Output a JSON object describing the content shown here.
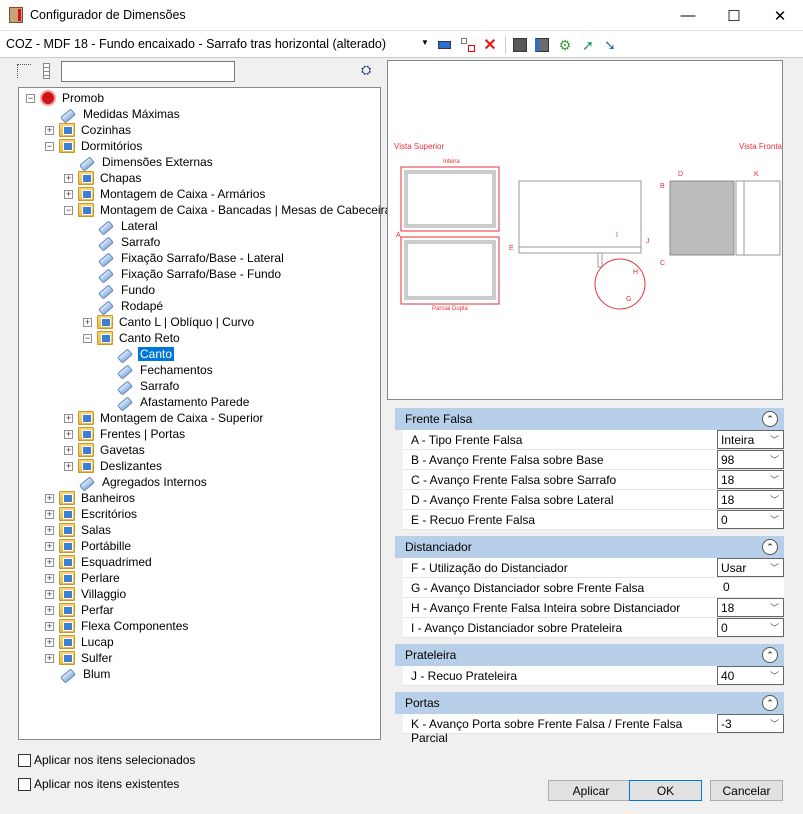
{
  "window": {
    "title": "Configurador de Dimensões",
    "minimize": "—",
    "maximize": "☐",
    "close": "✕"
  },
  "toolbar": {
    "config": "COZ - MDF 18 - Fundo encaixado - Sarrafo tras horizontal (alterado)"
  },
  "search": {
    "value": ""
  },
  "tree": [
    {
      "label": "Promob",
      "level": 0,
      "type": "root",
      "exp": "-"
    },
    {
      "label": "Medidas Máximas",
      "level": 1,
      "type": "tag"
    },
    {
      "label": "Cozinhas",
      "level": 1,
      "type": "folder",
      "exp": "+"
    },
    {
      "label": "Dormitórios",
      "level": 1,
      "type": "folder",
      "exp": "-"
    },
    {
      "label": "Dimensões Externas",
      "level": 2,
      "type": "tag"
    },
    {
      "label": "Chapas",
      "level": 2,
      "type": "folder",
      "exp": "+"
    },
    {
      "label": "Montagem de Caixa - Armários",
      "level": 2,
      "type": "folder",
      "exp": "+"
    },
    {
      "label": "Montagem de Caixa - Bancadas | Mesas de Cabeceira",
      "level": 2,
      "type": "folder",
      "exp": "-"
    },
    {
      "label": "Lateral",
      "level": 3,
      "type": "tag"
    },
    {
      "label": "Sarrafo",
      "level": 3,
      "type": "tag"
    },
    {
      "label": "Fixação Sarrafo/Base - Lateral",
      "level": 3,
      "type": "tag"
    },
    {
      "label": "Fixação Sarrafo/Base - Fundo",
      "level": 3,
      "type": "tag"
    },
    {
      "label": "Fundo",
      "level": 3,
      "type": "tag"
    },
    {
      "label": "Rodapé",
      "level": 3,
      "type": "tag"
    },
    {
      "label": "Canto L | Oblíquo | Curvo",
      "level": 3,
      "type": "folder",
      "exp": "+"
    },
    {
      "label": "Canto Reto",
      "level": 3,
      "type": "folder",
      "exp": "-"
    },
    {
      "label": "Canto",
      "level": 4,
      "type": "tag",
      "selected": true
    },
    {
      "label": "Fechamentos",
      "level": 4,
      "type": "tag"
    },
    {
      "label": "Sarrafo",
      "level": 4,
      "type": "tag"
    },
    {
      "label": "Afastamento Parede",
      "level": 4,
      "type": "tag"
    },
    {
      "label": "Montagem de Caixa - Superior",
      "level": 2,
      "type": "folder",
      "exp": "+"
    },
    {
      "label": "Frentes | Portas",
      "level": 2,
      "type": "folder",
      "exp": "+"
    },
    {
      "label": "Gavetas",
      "level": 2,
      "type": "folder",
      "exp": "+"
    },
    {
      "label": "Deslizantes",
      "level": 2,
      "type": "folder",
      "exp": "+"
    },
    {
      "label": "Agregados Internos",
      "level": 2,
      "type": "tag"
    },
    {
      "label": "Banheiros",
      "level": 1,
      "type": "folder",
      "exp": "+"
    },
    {
      "label": "Escritórios",
      "level": 1,
      "type": "folder",
      "exp": "+"
    },
    {
      "label": "Salas",
      "level": 1,
      "type": "folder",
      "exp": "+"
    },
    {
      "label": "Portábille",
      "level": 1,
      "type": "folder",
      "exp": "+"
    },
    {
      "label": "Esquadrimed",
      "level": 1,
      "type": "folder",
      "exp": "+"
    },
    {
      "label": "Perlare",
      "level": 1,
      "type": "folder",
      "exp": "+"
    },
    {
      "label": "Villaggio",
      "level": 1,
      "type": "folder",
      "exp": "+"
    },
    {
      "label": "Perfar",
      "level": 1,
      "type": "folder",
      "exp": "+"
    },
    {
      "label": "Flexa Componentes",
      "level": 1,
      "type": "folder",
      "exp": "+"
    },
    {
      "label": "Lucap",
      "level": 1,
      "type": "folder",
      "exp": "+"
    },
    {
      "label": "Sulfer",
      "level": 1,
      "type": "folder",
      "exp": "+"
    },
    {
      "label": "Blum",
      "level": 1,
      "type": "tag"
    }
  ],
  "diagram": {
    "top_view": "Vista Superior",
    "front_view": "Vista Frontal",
    "inteira": "Inteira",
    "parcial": "Parcial Dupla",
    "A": "A",
    "B": "B",
    "C": "C",
    "D": "D",
    "E": "E",
    "G": "G",
    "H": "H",
    "I": "I",
    "J": "J",
    "K": "K"
  },
  "properties": [
    {
      "section": "Frente Falsa",
      "rows": [
        {
          "name": "A - Tipo Frente Falsa",
          "value": "Inteira",
          "dropdown": true
        },
        {
          "name": "B - Avanço Frente Falsa sobre Base",
          "value": "98",
          "dropdown": true
        },
        {
          "name": "C - Avanço Frente Falsa sobre Sarrafo",
          "value": "18",
          "dropdown": true
        },
        {
          "name": "D - Avanço Frente Falsa sobre Lateral",
          "value": "18",
          "dropdown": true
        },
        {
          "name": "E - Recuo Frente Falsa",
          "value": "0",
          "dropdown": true
        }
      ]
    },
    {
      "section": "Distanciador",
      "rows": [
        {
          "name": "F - Utilização do Distanciador",
          "value": "Usar",
          "dropdown": true
        },
        {
          "name": "G - Avanço Distanciador sobre Frente Falsa",
          "value": "0",
          "dropdown": false
        },
        {
          "name": "H - Avanço Frente Falsa Inteira sobre Distanciador",
          "value": "18",
          "dropdown": true
        },
        {
          "name": "I - Avanço Distanciador sobre Prateleira",
          "value": "0",
          "dropdown": true
        }
      ]
    },
    {
      "section": "Prateleira",
      "rows": [
        {
          "name": "J - Recuo Prateleira",
          "value": "40",
          "dropdown": true
        }
      ]
    },
    {
      "section": "Portas",
      "rows": [
        {
          "name": "K - Avanço Porta sobre Frente Falsa / Frente Falsa Parcial",
          "value": "-3",
          "dropdown": true
        }
      ]
    }
  ],
  "options": {
    "apply_selected": "Aplicar nos itens selecionados",
    "apply_existing": "Aplicar nos itens existentes"
  },
  "buttons": {
    "apply": "Aplicar",
    "ok": "OK",
    "cancel": "Cancelar"
  }
}
